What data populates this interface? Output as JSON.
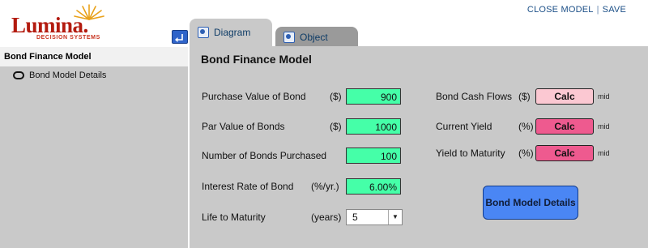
{
  "logo": {
    "brand": "Lumina.",
    "tagline": "DECISION SYSTEMS"
  },
  "header": {
    "close_model": "CLOSE MODEL",
    "separator": "|",
    "save": "SAVE"
  },
  "sidebar": {
    "model_title": "Bond Finance Model",
    "items": [
      {
        "label": "Bond Model Details",
        "icon": "module-oval-icon"
      }
    ]
  },
  "tabs": [
    {
      "label": "Diagram",
      "active": true,
      "icon": "diagram-icon"
    },
    {
      "label": "Object",
      "active": false,
      "icon": "object-icon"
    }
  ],
  "main": {
    "title": "Bond Finance Model",
    "inputs": [
      {
        "label": "Purchase Value of Bond",
        "unit": "($)",
        "value": "900"
      },
      {
        "label": "Par Value of Bonds",
        "unit": "($)",
        "value": "1000"
      },
      {
        "label": "Number of Bonds Purchased",
        "unit": "",
        "value": "100"
      },
      {
        "label": "Interest Rate of Bond",
        "unit": "(%/yr.)",
        "value": "6.00%"
      },
      {
        "label": "Life to Maturity",
        "unit": "(years)",
        "value": "5"
      }
    ],
    "outputs": [
      {
        "label": "Bond Cash Flows",
        "unit": "($)",
        "button": "Calc",
        "suffix": "mid"
      },
      {
        "label": "Current Yield",
        "unit": "(%)",
        "button": "Calc",
        "suffix": "mid"
      },
      {
        "label": "Yield to Maturity",
        "unit": "(%)",
        "button": "Calc",
        "suffix": "mid"
      }
    ],
    "details_button": "Bond Model Details"
  },
  "colors": {
    "brand_red": "#b31b0f",
    "input_green": "#45ffa8",
    "calc_light_pink": "#fbc8d2",
    "calc_pink": "#ee5a8f",
    "details_blue": "#4a86f4",
    "panel_gray": "#c9c9c9",
    "link_blue": "#1b4f87"
  }
}
